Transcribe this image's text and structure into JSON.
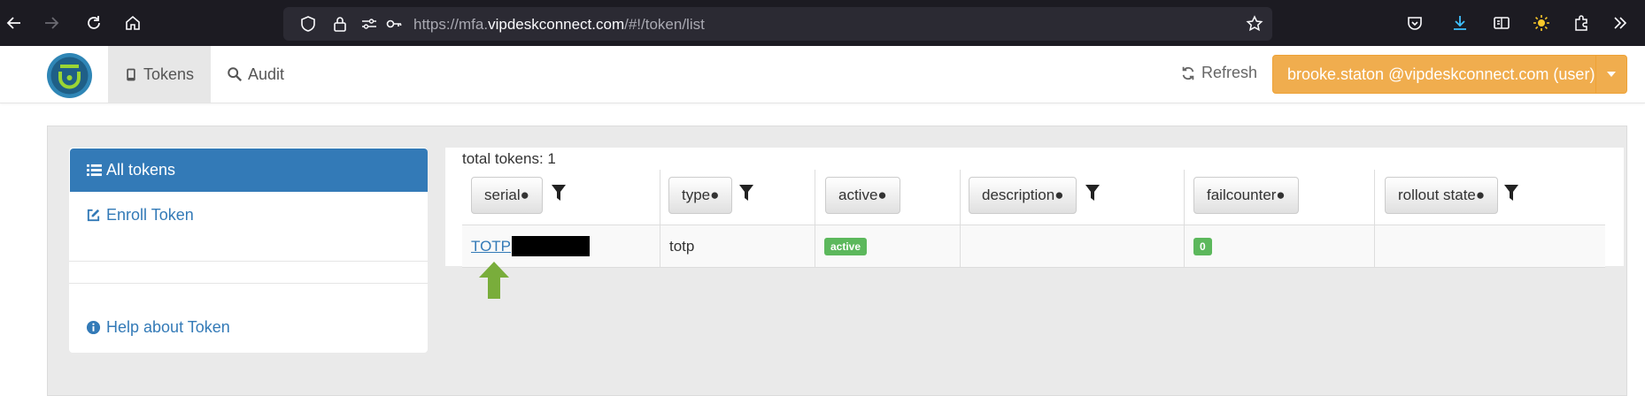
{
  "browser": {
    "url_prefix": "https://mfa.",
    "url_host": "vipdeskconnect.com",
    "url_path": "/#!/token/list"
  },
  "navbar": {
    "tabs": [
      {
        "label": "Tokens",
        "icon": "mobile-icon",
        "active": true
      },
      {
        "label": "Audit",
        "icon": "search-icon",
        "active": false
      }
    ],
    "refresh_label": "Refresh",
    "user_label": "brooke.staton @vipdeskconnect.com (user)",
    "accent_color": "#f0ad4e"
  },
  "sidebar": {
    "all_tokens_label": "All tokens",
    "enroll_label": "Enroll Token",
    "help_label": "Help about Token",
    "active_color": "#337ab7"
  },
  "table": {
    "total_label": "total tokens: 1",
    "columns": [
      {
        "label": "serial●",
        "filter": true
      },
      {
        "label": "type●",
        "filter": true
      },
      {
        "label": "active●",
        "filter": false
      },
      {
        "label": "description●",
        "filter": true
      },
      {
        "label": "failcounter●",
        "filter": false
      },
      {
        "label": "rollout state●",
        "filter": true
      }
    ],
    "rows": [
      {
        "serial": "TOTP",
        "type": "totp",
        "active": "active",
        "description": "",
        "failcounter": "0",
        "rollout_state": ""
      }
    ],
    "badge_color": "#5cb85c"
  }
}
